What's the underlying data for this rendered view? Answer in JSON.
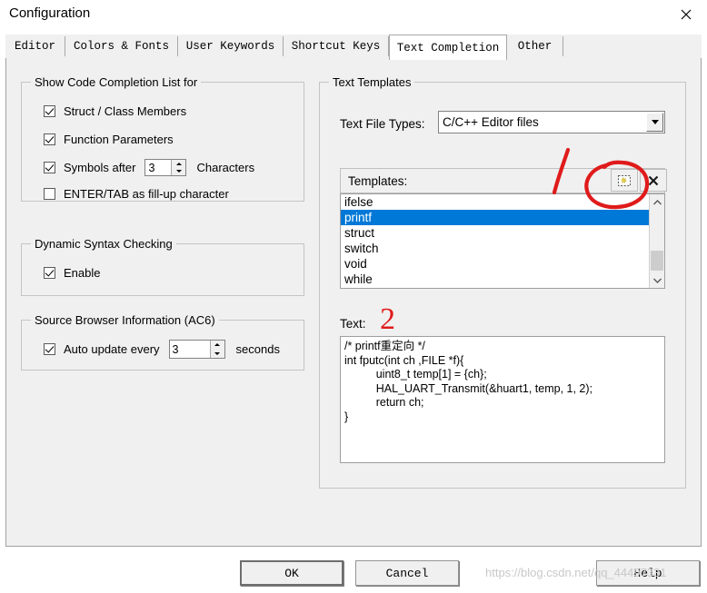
{
  "window": {
    "title": "Configuration",
    "close_icon": "close-icon"
  },
  "tabs": [
    {
      "label": "Editor",
      "selected": false
    },
    {
      "label": "Colors & Fonts",
      "selected": false
    },
    {
      "label": "User Keywords",
      "selected": false
    },
    {
      "label": "Shortcut Keys",
      "selected": false
    },
    {
      "label": "Text Completion",
      "selected": true
    },
    {
      "label": "Other",
      "selected": false
    }
  ],
  "left_panel": {
    "code_completion_group": {
      "title": "Show Code Completion List for",
      "items": [
        {
          "label": "Struct / Class Members",
          "checked": true
        },
        {
          "label": "Function Parameters",
          "checked": true
        },
        {
          "label": "Symbols after",
          "checked": true,
          "value": "3",
          "suffix": "Characters"
        },
        {
          "label": "ENTER/TAB as fill-up character",
          "checked": false
        }
      ]
    },
    "syntax_group": {
      "title": "Dynamic Syntax Checking",
      "items": [
        {
          "label": "Enable",
          "checked": true
        }
      ]
    },
    "browser_group": {
      "title": "Source Browser Information (AC6)",
      "items": [
        {
          "label": "Auto update every",
          "checked": true,
          "value": "3",
          "suffix": "seconds"
        }
      ]
    }
  },
  "right_panel": {
    "group_title": "Text Templates",
    "file_types_label": "Text File Types:",
    "file_types_value": "C/C++ Editor files",
    "templates_label": "Templates:",
    "new_icon": "new-template-icon",
    "delete_icon": "delete-template-icon",
    "templates": [
      {
        "name": "ifelse",
        "selected": false
      },
      {
        "name": "printf",
        "selected": true
      },
      {
        "name": "struct",
        "selected": false
      },
      {
        "name": "switch",
        "selected": false
      },
      {
        "name": "void",
        "selected": false
      },
      {
        "name": "while",
        "selected": false
      }
    ],
    "scrollbar": {
      "up_icon": "chevron-up-icon",
      "down_icon": "chevron-down-icon"
    },
    "text_label": "Text:",
    "text_value": "/* printf重定向 */\nint fputc(int ch ,FILE *f){\n          uint8_t temp[1] = {ch};\n          HAL_UART_Transmit(&huart1, temp, 1, 2);\n          return ch;\n}"
  },
  "buttons": {
    "ok": "OK",
    "cancel": "Cancel",
    "help": "Help"
  },
  "watermark": "https://blog.csdn.net/qq_44497331",
  "annotations": {
    "marker_one": "1",
    "marker_two": "2",
    "color": "#e01b1b"
  },
  "colors": {
    "selection_blue": "#0078d7",
    "dialog_face": "#f0f0f0",
    "annotation_red": "#e01b1b"
  }
}
